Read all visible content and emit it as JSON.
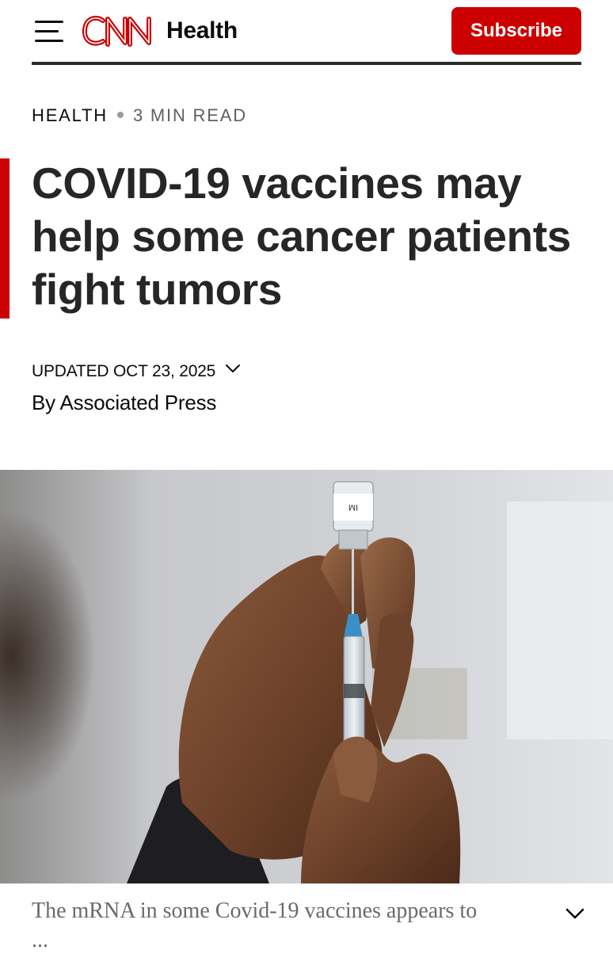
{
  "header": {
    "brand": "CNN",
    "section": "Health",
    "subscribe_label": "Subscribe",
    "menu_icon": "hamburger-icon",
    "brand_color": "#cc0000"
  },
  "article": {
    "kicker_category": "HEALTH",
    "kicker_readtime": "3 MIN READ",
    "headline": "COVID-19 vaccines may help some cancer patients fight tumors",
    "updated": "UPDATED OCT 23, 2025",
    "updated_toggle_icon": "chevron-down-icon",
    "byline": "By Associated Press"
  },
  "hero": {
    "image_subject": "gloved hand drawing vaccine from vial into syringe",
    "vial_label": "IM"
  },
  "caption": {
    "text": "The mRNA in some Covid-19 vaccines appears to",
    "ellipsis": "...",
    "expand_icon": "chevron-down-icon"
  },
  "colors": {
    "accent": "#cc0000",
    "text": "#262626",
    "muted": "#6a6a6a"
  }
}
